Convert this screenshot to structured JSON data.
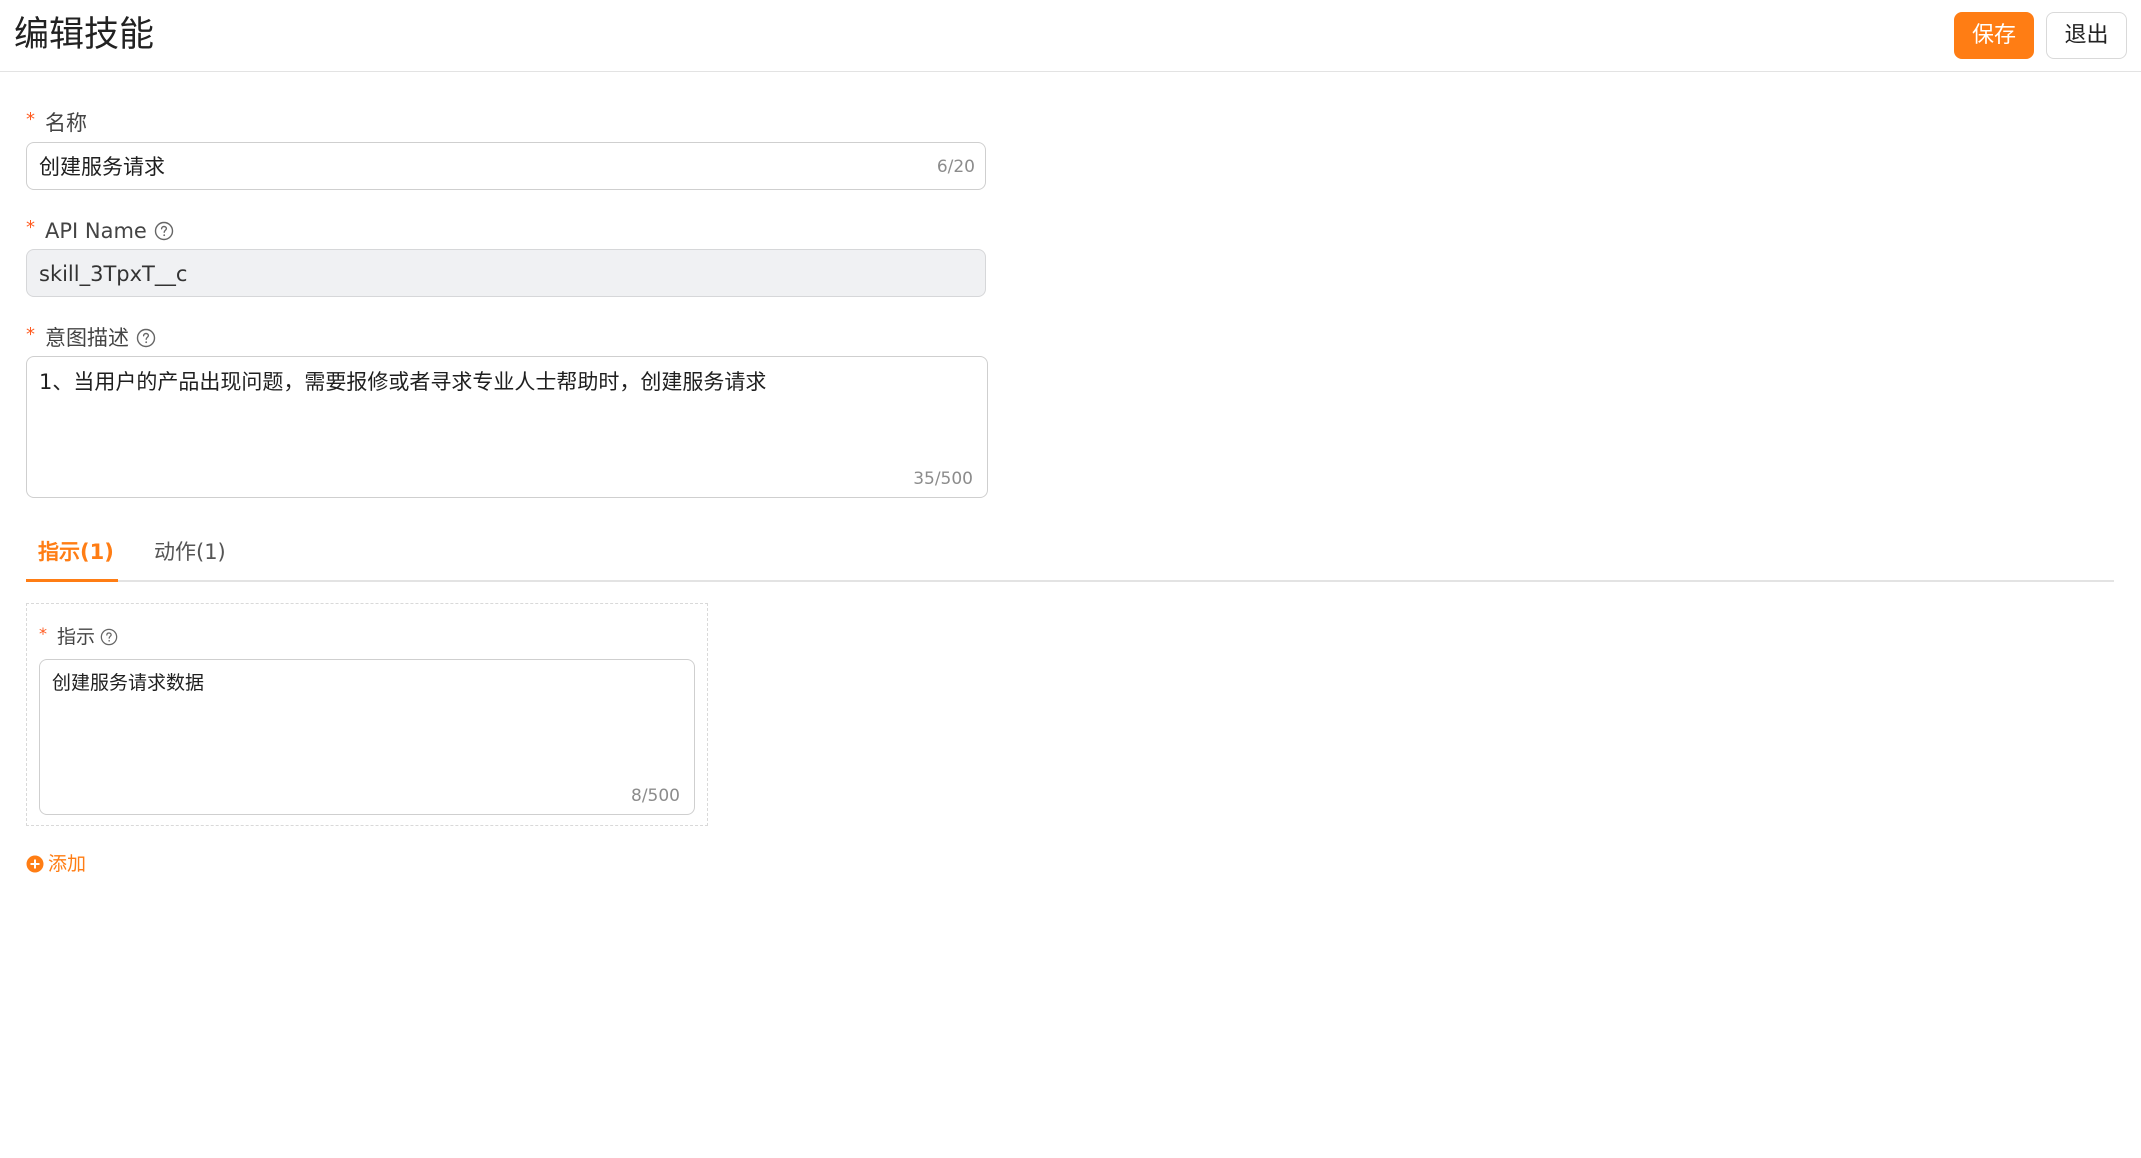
{
  "header": {
    "title": "编辑技能",
    "save_label": "保存",
    "exit_label": "退出"
  },
  "form": {
    "name": {
      "label": "名称",
      "value": "创建服务请求",
      "counter": "6/20"
    },
    "api_name": {
      "label": "API Name",
      "value": "skill_3TpxT__c"
    },
    "intent": {
      "label": "意图描述",
      "value": "1、当用户的产品出现问题，需要报修或者寻求专业人士帮助时，创建服务请求",
      "counter": "35/500"
    },
    "required_mark": "*"
  },
  "tabs": [
    {
      "label": "指示(1)",
      "active": true
    },
    {
      "label": "动作(1)",
      "active": false
    }
  ],
  "instruction": {
    "label": "指示",
    "value": "创建服务请求数据",
    "counter": "8/500"
  },
  "add_label": "添加",
  "colors": {
    "accent": "#ff7d14",
    "required": "#ff5a1f"
  },
  "icons": {
    "help": "help-circle-icon",
    "add": "plus-circle-icon"
  }
}
